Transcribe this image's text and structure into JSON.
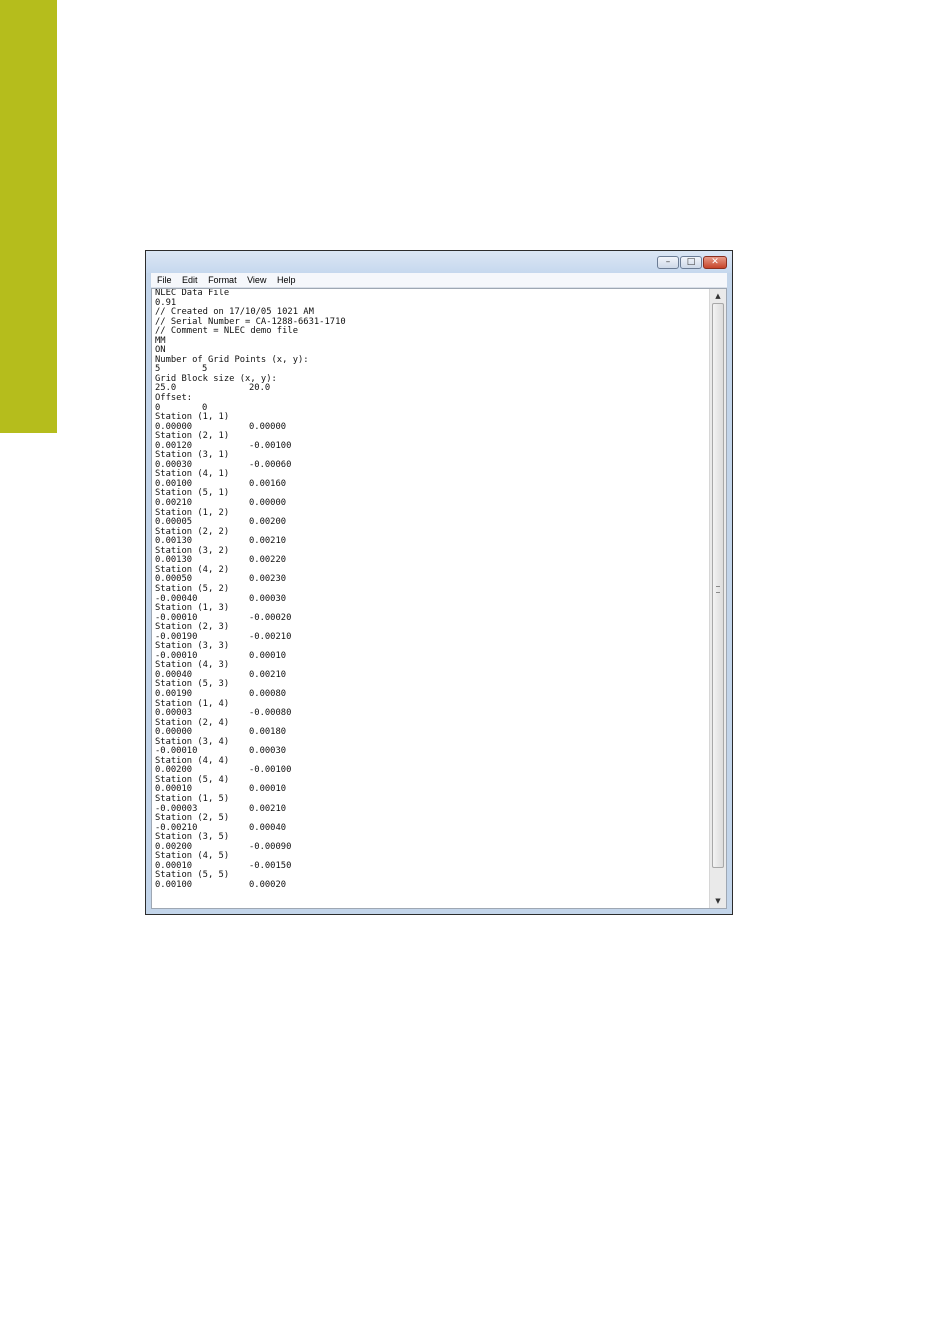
{
  "window": {
    "controls": {
      "minimize": "–",
      "maximize": "□",
      "close": "✕"
    },
    "menu": [
      "File",
      "Edit",
      "Format",
      "View",
      "Help"
    ]
  },
  "document": {
    "header_lines": [
      "NLEC Data File",
      "0.91",
      "// Created on 17/10/05 1021 AM",
      "// Serial Number = CA-1288-6631-1710",
      "// Comment = NLEC demo file",
      "MM",
      "ON",
      "Number of Grid Points (x, y):"
    ],
    "grid_points": [
      "5",
      "5"
    ],
    "grid_block_label": "Grid Block size (x, y):",
    "grid_block": [
      "25.0",
      "20.0"
    ],
    "offset_label": "Offset:",
    "offset": [
      "0",
      "0"
    ],
    "stations": [
      {
        "label": "Station (1, 1)",
        "x": "0.00000",
        "y": "0.00000"
      },
      {
        "label": "Station (2, 1)",
        "x": "0.00120",
        "y": "-0.00100"
      },
      {
        "label": "Station (3, 1)",
        "x": "0.00030",
        "y": "-0.00060"
      },
      {
        "label": "Station (4, 1)",
        "x": "0.00100",
        "y": "0.00160"
      },
      {
        "label": "Station (5, 1)",
        "x": "0.00210",
        "y": "0.00000"
      },
      {
        "label": "Station (1, 2)",
        "x": "0.00005",
        "y": "0.00200"
      },
      {
        "label": "Station (2, 2)",
        "x": "0.00130",
        "y": "0.00210"
      },
      {
        "label": "Station (3, 2)",
        "x": "0.00130",
        "y": "0.00220"
      },
      {
        "label": "Station (4, 2)",
        "x": "0.00050",
        "y": "0.00230"
      },
      {
        "label": "Station (5, 2)",
        "x": "-0.00040",
        "y": "0.00030"
      },
      {
        "label": "Station (1, 3)",
        "x": "-0.00010",
        "y": "-0.00020"
      },
      {
        "label": "Station (2, 3)",
        "x": "-0.00190",
        "y": "-0.00210"
      },
      {
        "label": "Station (3, 3)",
        "x": "-0.00010",
        "y": "0.00010"
      },
      {
        "label": "Station (4, 3)",
        "x": "0.00040",
        "y": "0.00210"
      },
      {
        "label": "Station (5, 3)",
        "x": "0.00190",
        "y": "0.00080"
      },
      {
        "label": "Station (1, 4)",
        "x": "0.00003",
        "y": "-0.00080"
      },
      {
        "label": "Station (2, 4)",
        "x": "0.00000",
        "y": "0.00180"
      },
      {
        "label": "Station (3, 4)",
        "x": "-0.00010",
        "y": "0.00030"
      },
      {
        "label": "Station (4, 4)",
        "x": "0.00200",
        "y": "-0.00100"
      },
      {
        "label": "Station (5, 4)",
        "x": "0.00010",
        "y": "0.00010"
      },
      {
        "label": "Station (1, 5)",
        "x": "-0.00003",
        "y": "0.00210"
      },
      {
        "label": "Station (2, 5)",
        "x": "-0.00210",
        "y": "0.00040"
      },
      {
        "label": "Station (3, 5)",
        "x": "0.00200",
        "y": "-0.00090"
      },
      {
        "label": "Station (4, 5)",
        "x": "0.00010",
        "y": "-0.00150"
      },
      {
        "label": "Station (5, 5)",
        "x": "0.00100",
        "y": "0.00020"
      }
    ]
  },
  "scrollbar": {
    "up_arrow": "▲",
    "down_arrow": "▼"
  },
  "colors": {
    "side_bar": "#b5bd1c"
  }
}
